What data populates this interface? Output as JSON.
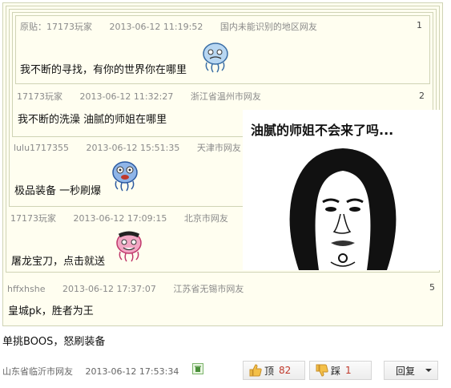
{
  "posts": [
    {
      "author": "原贴：17173玩家",
      "time": "2013-06-12 11:19:52",
      "location": "国内未能识别的地区网友",
      "floor": "1",
      "content": "我不断的寻找，有你的世界你在哪里"
    },
    {
      "author": "17173玩家",
      "time": "2013-06-12 11:32:27",
      "location": "浙江省温州市网友",
      "floor": "2",
      "content": "我不断的洗澡 油腻的师姐在哪里"
    },
    {
      "author": "lulu1717355",
      "time": "2013-06-12 15:51:35",
      "location": "天津市网友",
      "floor": "",
      "content": "极品装备 一秒刷爆"
    },
    {
      "author": "17173玩家",
      "time": "2013-06-12 17:09:15",
      "location": "北京市网友",
      "floor": "",
      "content": "屠龙宝刀，点击就送"
    },
    {
      "author": "hffxhshe",
      "time": "2013-06-12 17:37:07",
      "location": "江苏省无锡市网友",
      "floor": "5",
      "content": "皇城pk，胜者为王"
    }
  ],
  "reply": {
    "content": "单挑BOOS，怒刷装备",
    "location": "山东省临沂市网友",
    "time": "2013-06-12 17:53:34"
  },
  "actions": {
    "up_label": "顶",
    "up_count": "82",
    "down_label": "踩",
    "down_count": "1",
    "reply_label": "回复"
  },
  "meme": {
    "caption": "油腻的师姐不会来了吗..."
  },
  "icons": [
    "thumb-up-icon",
    "thumb-down-icon",
    "chevron-down-icon",
    "trash-icon",
    "jellyfish-emoji-icon"
  ]
}
